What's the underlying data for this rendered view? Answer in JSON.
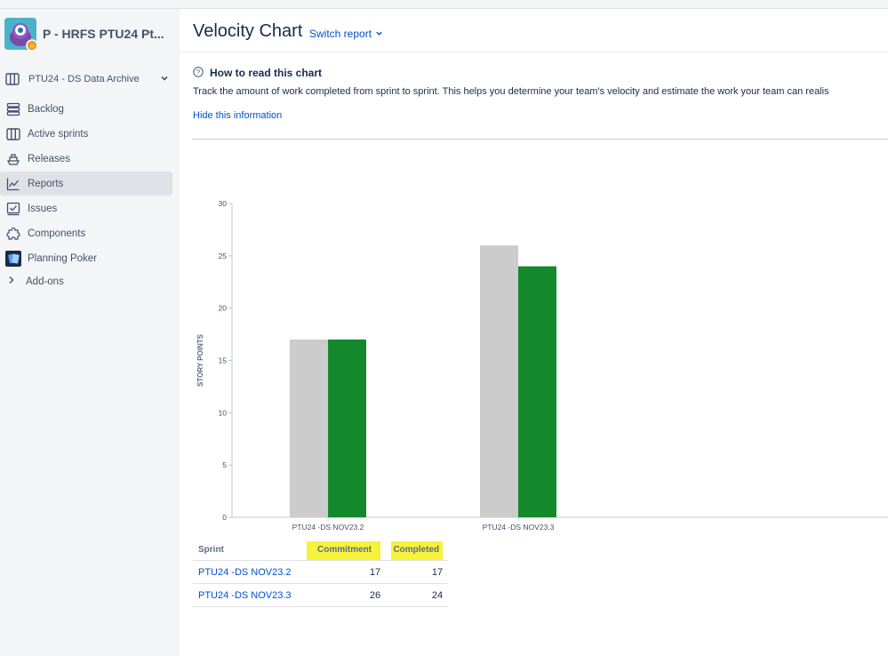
{
  "sidebar": {
    "project_title": "P - HRFS PTU24 Pt...",
    "board_name": "PTU24 - DS Data Archive",
    "items": [
      {
        "label": "Backlog",
        "icon": "backlog-icon"
      },
      {
        "label": "Active sprints",
        "icon": "board-icon"
      },
      {
        "label": "Releases",
        "icon": "ship-icon"
      },
      {
        "label": "Reports",
        "icon": "chart-line-icon"
      },
      {
        "label": "Issues",
        "icon": "issues-icon"
      },
      {
        "label": "Components",
        "icon": "puzzle-icon"
      },
      {
        "label": "Planning Poker",
        "icon": "poker-icon"
      }
    ],
    "addons_label": "Add-ons"
  },
  "header": {
    "title": "Velocity Chart",
    "switch_report": "Switch report"
  },
  "howto": {
    "title": "How to read this chart",
    "text": "Track the amount of work completed from sprint to sprint. This helps you determine your team's velocity and estimate the work your team can realis",
    "hide_link": "Hide this information"
  },
  "chart_data": {
    "type": "bar",
    "categories": [
      "PTU24 -DS NOV23.2",
      "PTU24 -DS NOV23.3"
    ],
    "series": [
      {
        "name": "Commitment",
        "values": [
          17,
          26
        ],
        "color": "#cccccc"
      },
      {
        "name": "Completed",
        "values": [
          17,
          24
        ],
        "color": "#14892c"
      }
    ],
    "ylabel": "STORY POINTS",
    "ylim": [
      0,
      30
    ],
    "yticks": [
      0,
      5,
      10,
      15,
      20,
      25,
      30
    ]
  },
  "table": {
    "headers": {
      "sprint": "Sprint",
      "commitment": "Commitment",
      "completed": "Completed"
    },
    "rows": [
      {
        "sprint": "PTU24 -DS NOV23.2",
        "commitment": "17",
        "completed": "17"
      },
      {
        "sprint": "PTU24 -DS NOV23.3",
        "commitment": "26",
        "completed": "24"
      }
    ],
    "highlight_color": "#f7f23a"
  }
}
